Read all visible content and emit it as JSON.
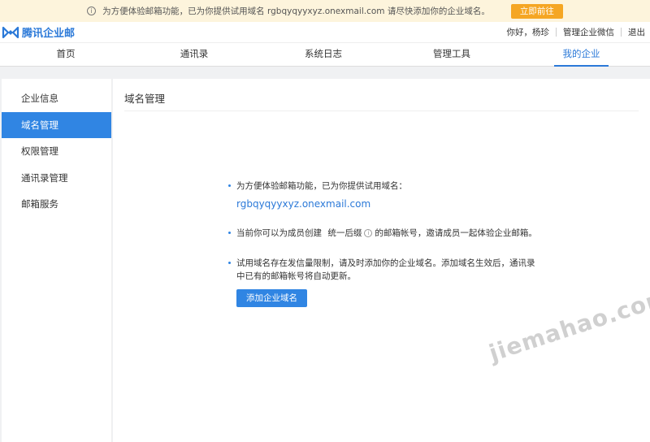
{
  "notice": {
    "text": "为方便体验邮箱功能，已为你提供试用域名 rgbqyqyyxyz.onexmail.com 请尽快添加你的企业域名。",
    "icon": "info-icon",
    "button_label": "立即前往",
    "background": "#fdf4dc",
    "button_color": "#f5a623"
  },
  "header": {
    "logo_text": "腾讯企业邮",
    "greeting": "你好，杨珍",
    "links": [
      "管理企业微信",
      "退出"
    ]
  },
  "nav": {
    "items": [
      "首页",
      "通讯录",
      "系统日志",
      "管理工具",
      "我的企业"
    ],
    "active": "我的企业"
  },
  "sidebar": {
    "items": [
      "企业信息",
      "域名管理",
      "权限管理",
      "通讯录管理",
      "邮箱服务"
    ],
    "active": "域名管理"
  },
  "main": {
    "title": "域名管理",
    "tip1": "为方便体验邮箱功能，已为你提供试用域名：",
    "domain": "rgbqyqyyxyz.onexmail.com",
    "tip2_a": "当前你可以为成员创建",
    "tip2_b": "统一后缀",
    "tip2_c": "的邮箱帐号，邀请成员一起体验企业邮箱。",
    "tip3": "试用域名存在发信量限制，请及时添加你的企业域名。添加域名生效后，通讯录中已有的邮箱帐号将自动更新。",
    "add_button": "添加企业域名"
  },
  "watermark": "jiemahao.com",
  "colors": {
    "accent": "#3085e3",
    "link": "#2b79d8"
  }
}
